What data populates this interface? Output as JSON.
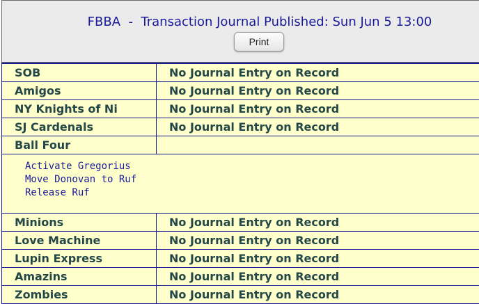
{
  "header": {
    "title": "FBBA  -  Transaction Journal Published: Sun Jun 5 13:00",
    "print_label": "Print"
  },
  "rows": [
    {
      "team": "SOB",
      "entry": "No Journal Entry on Record"
    },
    {
      "team": "Amigos",
      "entry": "No Journal Entry on Record"
    },
    {
      "team": "NY Knights of Ni",
      "entry": "No Journal Entry on Record"
    },
    {
      "team": "SJ Cardenals",
      "entry": "No Journal Entry on Record"
    },
    {
      "team": "Ball Four",
      "entry": ""
    },
    {
      "team": "Minions",
      "entry": "No Journal Entry on Record"
    },
    {
      "team": "Love Machine",
      "entry": "No Journal Entry on Record"
    },
    {
      "team": "Lupin Express",
      "entry": "No Journal Entry on Record"
    },
    {
      "team": "Amazins",
      "entry": "No Journal Entry on Record"
    },
    {
      "team": "Zombies",
      "entry": "No Journal Entry on Record"
    }
  ],
  "ball_four_details": [
    "Activate Gregorius",
    "Move Donovan to Ruf",
    "Release Ruf"
  ],
  "colors": {
    "header_bg": "#ebebeb",
    "title_text": "#1a1a99",
    "row_bg": "#ffffcc",
    "row_text": "#244747",
    "border": "#1a1a99"
  }
}
